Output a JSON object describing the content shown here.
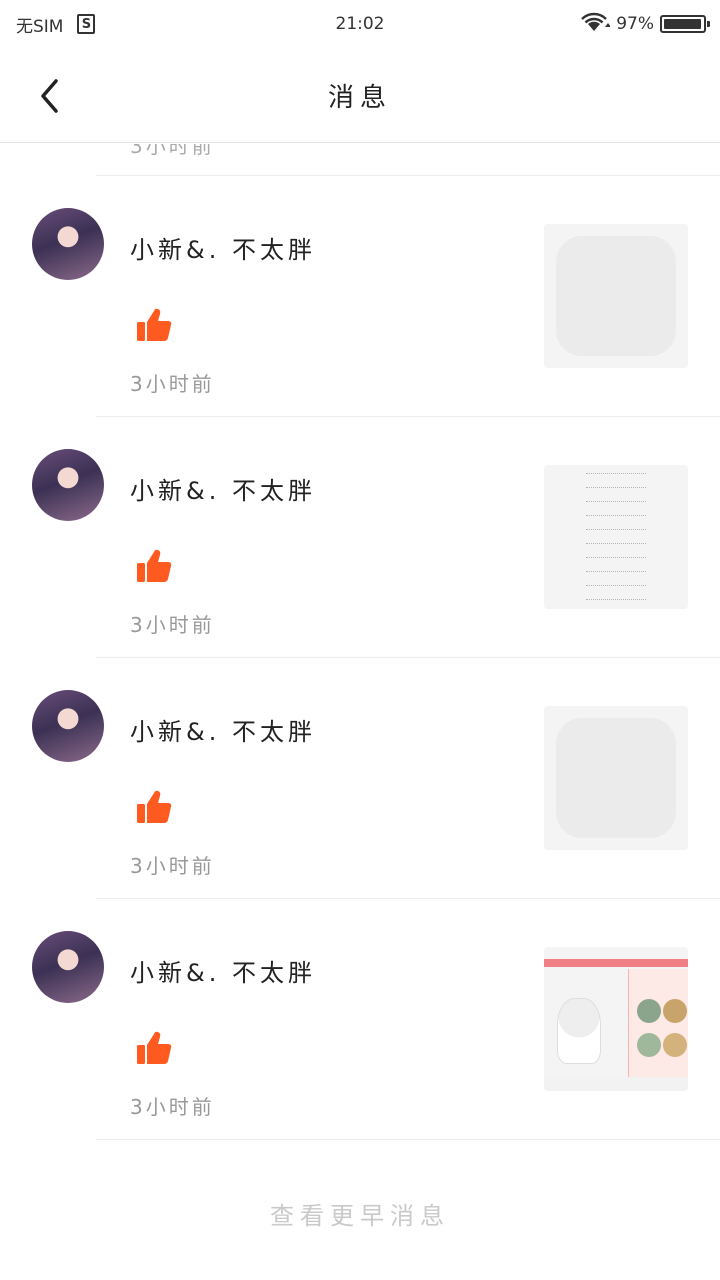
{
  "status_bar": {
    "carrier": "无SIM",
    "sim_icon_label": "S",
    "time": "21:02",
    "battery_percent": "97%",
    "battery_level": 0.97
  },
  "nav": {
    "title": "消息",
    "back_icon": "chevron-left-icon"
  },
  "partial_item": {
    "time_ago": "3小时前"
  },
  "messages": [
    {
      "user_name": "小新&. 不太胖",
      "action_icon": "thumbs-up-icon",
      "time_ago": "3小时前",
      "thumbnail": "placeholder"
    },
    {
      "user_name": "小新&. 不太胖",
      "action_icon": "thumbs-up-icon",
      "time_ago": "3小时前",
      "thumbnail": "document"
    },
    {
      "user_name": "小新&. 不太胖",
      "action_icon": "thumbs-up-icon",
      "time_ago": "3小时前",
      "thumbnail": "placeholder"
    },
    {
      "user_name": "小新&. 不太胖",
      "action_icon": "thumbs-up-icon",
      "time_ago": "3小时前",
      "thumbnail": "game-screenshot"
    }
  ],
  "footer": {
    "more_label": "查看更早消息"
  },
  "colors": {
    "like_orange": "#ff5a1f",
    "divider": "#ececec",
    "muted_text": "#999999"
  }
}
